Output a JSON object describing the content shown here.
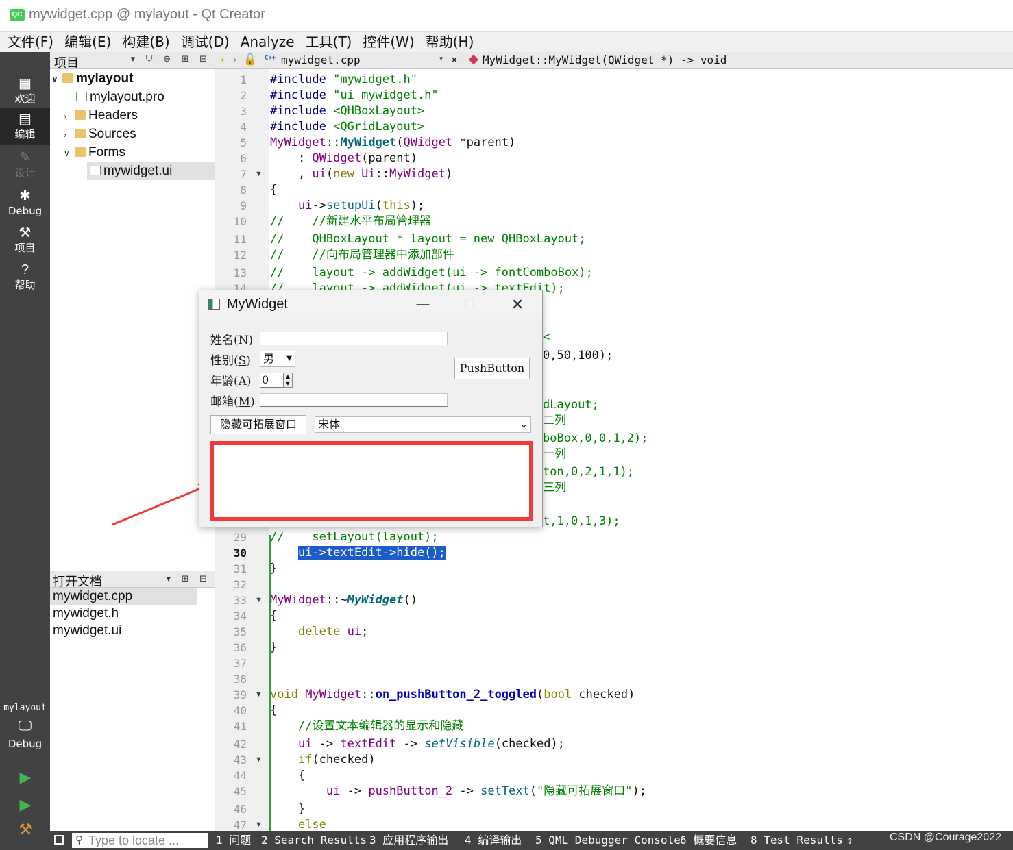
{
  "window": {
    "title": "mywidget.cpp @ mylayout - Qt Creator",
    "app_icon_text": "QC"
  },
  "menu": [
    "文件(F)",
    "编辑(E)",
    "构建(B)",
    "调试(D)",
    "Analyze",
    "工具(T)",
    "控件(W)",
    "帮助(H)"
  ],
  "modes": {
    "welcome": "欢迎",
    "edit": "编辑",
    "design": "设计",
    "debug": "Debug",
    "projects": "项目",
    "help": "帮助",
    "target_project": "mylayout",
    "target_config": "Debug"
  },
  "project_pane": {
    "title": "项目",
    "tree": {
      "root": "mylayout",
      "pro": "mylayout.pro",
      "headers": "Headers",
      "sources": "Sources",
      "forms": "Forms",
      "ui": "mywidget.ui"
    }
  },
  "open_docs": {
    "title": "打开文档",
    "items": [
      "mywidget.cpp",
      "mywidget.h",
      "mywidget.ui"
    ]
  },
  "editor": {
    "file_name": "mywidget.cpp",
    "symbol": "MyWidget::MyWidget(QWidget *) -> void",
    "current_line": 30
  },
  "code_lines": {
    "l1": "\"mywidget.h\"",
    "l2": "\"ui_mywidget.h\"",
    "l3": "<QHBoxLayout>",
    "l4": "<QGridLayout>",
    "l10": "//    //新建水平布局管理器",
    "l11": "//    QHBoxLayout * layout = new QHBoxLayout;",
    "l12": "//    //向布局管理器中添加部件",
    "l13": "//    layout -> addWidget(ui -> fontComboBox);",
    "l14": "//    layout -> addWidget(ui -> textEdit);",
    "f15": "<",
    "f16": "0,50,100);",
    "f17": "dLayout;",
    "f18": "二列",
    "f19": "boBox,0,0,1,2);",
    "f20": "一列",
    "f21": "ton,0,2,1,1);",
    "f22": "三列",
    "f23": "t,1,0,1,3);",
    "l29": "//    setLayout(layout);",
    "l30": "ui->textEdit->hide();",
    "l41": "//设置文本编辑器的显示和隐藏",
    "l45_str": "\"隐藏可拓展窗口\""
  },
  "dialog": {
    "title": "MyWidget",
    "minimize": "—",
    "maximize": "☐",
    "close": "✕",
    "labels": {
      "name": "姓名",
      "name_key": "N",
      "gender": "性别",
      "gender_key": "S",
      "age": "年龄",
      "age_key": "A",
      "email": "邮箱",
      "email_key": "M"
    },
    "gender_value": "男",
    "age_value": "0",
    "push_button": "PushButton",
    "toggle_button": "隐藏可拓展窗口",
    "font_value": "宋体"
  },
  "statusbar": {
    "locator_placeholder": "Type to locate ...",
    "tabs": [
      "1 问题",
      "2 Search Results",
      "3 应用程序输出",
      "4 编译输出",
      "5 QML Debugger Console",
      "6 概要信息",
      "8 Test Results"
    ],
    "watermark": "CSDN @Courage2022"
  }
}
